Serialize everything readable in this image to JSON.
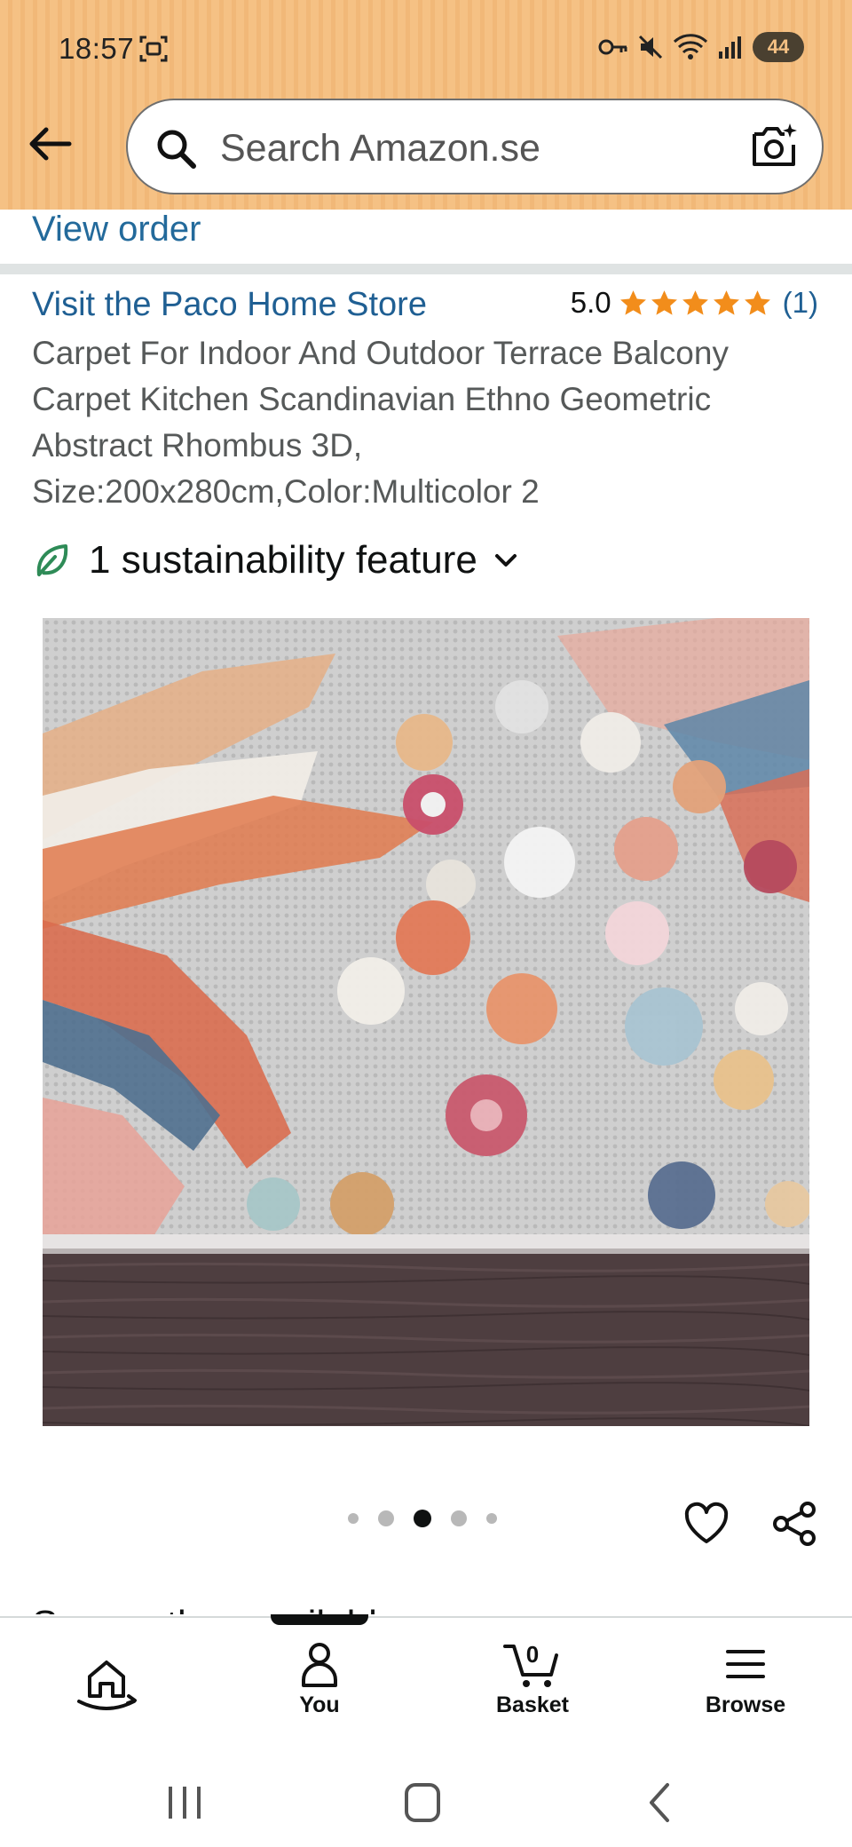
{
  "status_bar": {
    "time": "18:57",
    "battery": "44"
  },
  "search": {
    "placeholder": "Search Amazon.se"
  },
  "order": {
    "view_order": "View order"
  },
  "product": {
    "store_link": "Visit the Paco Home Store",
    "rating_value": "5.0",
    "rating_stars": 5,
    "rating_count": "(1)",
    "title": "Carpet For Indoor And Outdoor Terrace Balcony Carpet Kitchen Scandinavian Ethno Geometric Abstract Rhombus 3D, Size:200x280cm,Color:Multicolor 2",
    "sustainability": "1 sustainability feature",
    "image_count": 5,
    "active_image": 3
  },
  "next_section": {
    "heading_partial": "Some other available"
  },
  "bottom_nav": {
    "home": "",
    "you": "You",
    "basket": "Basket",
    "basket_count": "0",
    "browse": "Browse"
  },
  "colors": {
    "header_bg": "#f5c184",
    "link": "#1f5f93",
    "star": "#f28d1b",
    "leaf": "#2e8b57"
  }
}
